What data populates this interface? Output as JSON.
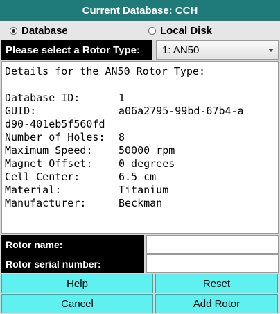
{
  "title": "Current Database: CCH",
  "source": {
    "database_label": "Database",
    "local_disk_label": "Local Disk",
    "selected": "database"
  },
  "rotor_type": {
    "label": "Please select a Rotor Type:",
    "selected_value": "1: AN50"
  },
  "details": {
    "heading": "Details for the AN50 Rotor Type:",
    "database_id_key": "Database ID:",
    "database_id": "1",
    "guid_key": "GUID:",
    "guid": "a06a2795-99bd-67b4-ad90-401eb5f560fd",
    "holes_key": "Number of Holes:",
    "holes": "8",
    "max_speed_key": "Maximum Speed:",
    "max_speed": "50000 rpm",
    "magnet_offset_key": "Magnet Offset:",
    "magnet_offset": "0 degrees",
    "cell_center_key": "Cell Center:",
    "cell_center": "6.5 cm",
    "material_key": "Material:",
    "material": "Titanium",
    "manufacturer_key": "Manufacturer:",
    "manufacturer": "Beckman"
  },
  "fields": {
    "rotor_name_label": "Rotor name:",
    "rotor_name_value": "",
    "serial_label": "Rotor serial number:",
    "serial_value": ""
  },
  "buttons": {
    "help": "Help",
    "reset": "Reset",
    "cancel": "Cancel",
    "add_rotor": "Add Rotor"
  },
  "colors": {
    "title_bar": "#1f7a7a",
    "button": "#5ff0f0",
    "label_bg": "#000000"
  }
}
